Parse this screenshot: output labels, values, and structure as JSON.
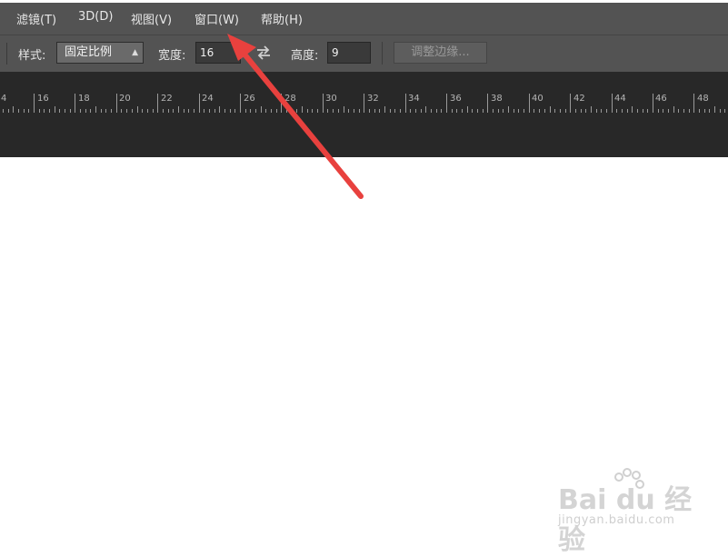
{
  "menubar": {
    "items": [
      {
        "label": "滤镜(T)"
      },
      {
        "label": "3D(D)"
      },
      {
        "label": "视图(V)"
      },
      {
        "label": "窗口(W)"
      },
      {
        "label": "帮助(H)"
      }
    ]
  },
  "options": {
    "style_label": "样式:",
    "style_value": "固定比例",
    "width_label": "宽度:",
    "width_value": "16",
    "height_label": "高度:",
    "height_value": "9",
    "refine_edge_label": "调整边缘..."
  },
  "ruler": {
    "labels": [
      "4",
      "16",
      "18",
      "20",
      "22",
      "24",
      "26",
      "28",
      "30",
      "32",
      "34",
      "36",
      "38",
      "40",
      "42",
      "44",
      "46",
      "48"
    ]
  },
  "watermark": {
    "brand": "Bai du 经验",
    "url": "jingyan.baidu.com"
  },
  "colors": {
    "toolbar_bg": "#535353",
    "ruler_bg": "#282828",
    "annotation_arrow": "#e8413e"
  },
  "icons": {
    "swap": "swap-arrows-icon",
    "select_arrow": "updown-chevron-icon",
    "annotation": "red-arrow-pointer"
  }
}
